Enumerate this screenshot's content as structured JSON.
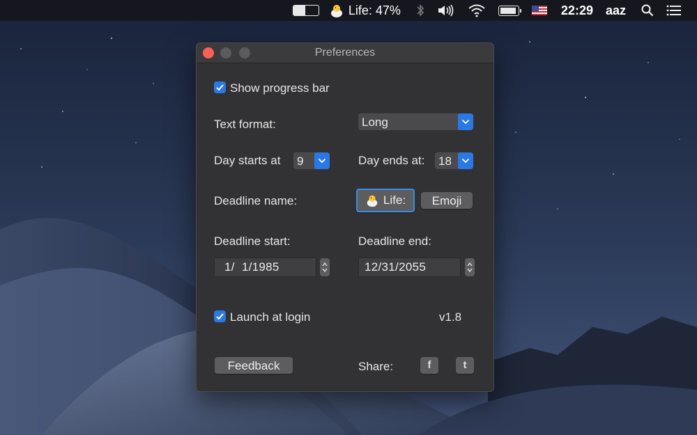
{
  "menubar": {
    "progress_fraction": 0.47,
    "app_status": "Life: 47%",
    "time": "22:29",
    "user": "aaz",
    "icons": [
      "progress-bar-icon",
      "chick-emoji-icon",
      "bluetooth-icon",
      "volume-icon",
      "wifi-icon",
      "battery-icon",
      "us-flag-icon",
      "spotlight-search-icon",
      "notification-center-icon"
    ]
  },
  "window": {
    "title": "Preferences",
    "show_progress_bar": {
      "label": "Show progress bar",
      "checked": true
    },
    "text_format": {
      "label": "Text format:",
      "value": "Long"
    },
    "day_starts": {
      "label": "Day starts at",
      "value": "9"
    },
    "day_ends": {
      "label": "Day ends at:",
      "value": "18"
    },
    "deadline_name": {
      "label": "Deadline name:",
      "value": "Life:",
      "emoji_button": "Emoji"
    },
    "deadline_start": {
      "label": "Deadline start:",
      "value": "1/  1/1985"
    },
    "deadline_end": {
      "label": "Deadline end:",
      "value": "12/31/2055"
    },
    "launch_at_login": {
      "label": "Launch at login",
      "checked": true
    },
    "version": "v1.8",
    "feedback_button": "Feedback",
    "share_label": "Share:",
    "share_facebook": "f",
    "share_twitter": "t"
  },
  "colors": {
    "accent": "#2b78e4",
    "close": "#fc5f57",
    "window_bg": "#323234"
  }
}
